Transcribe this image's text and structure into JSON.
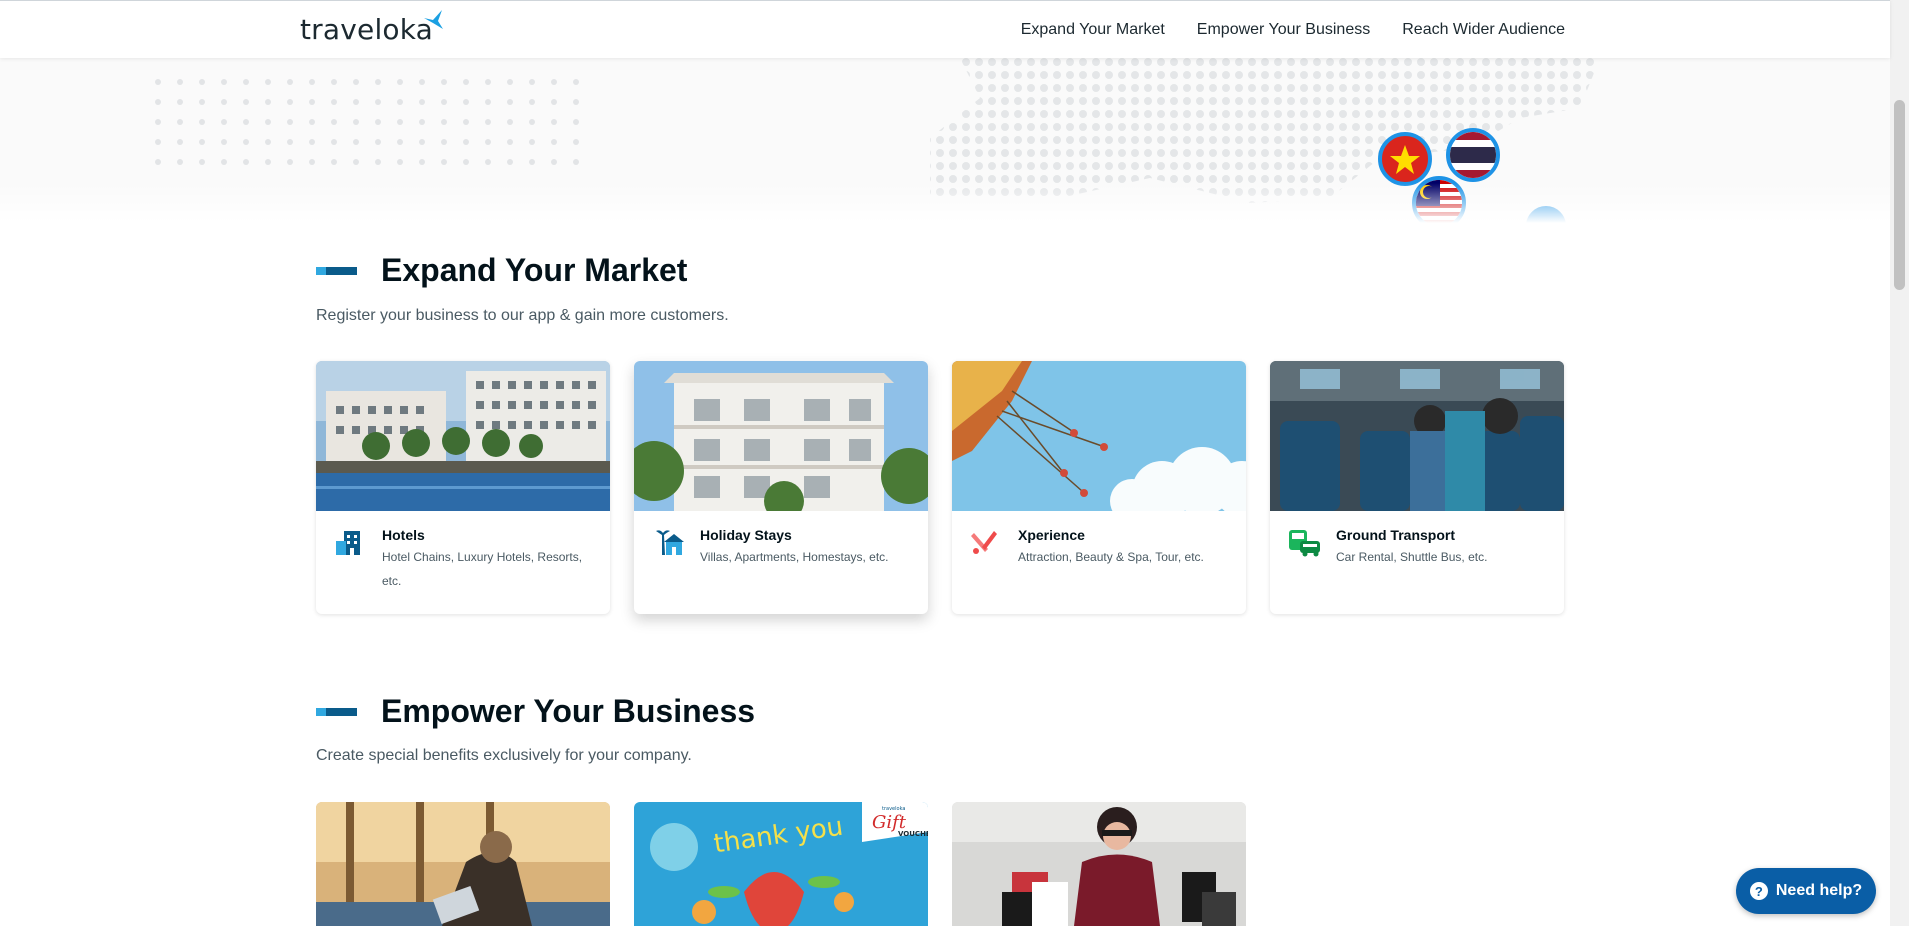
{
  "header": {
    "logo_text": "traveloka",
    "nav": [
      "Expand Your Market",
      "Empower Your Business",
      "Reach Wider Audience"
    ]
  },
  "sections": {
    "expand": {
      "title": "Expand Your Market",
      "subtitle": "Register your business to our app & gain more customers.",
      "cards": [
        {
          "title": "Hotels",
          "desc": "Hotel Chains, Luxury Hotels, Resorts, etc.",
          "icon": "hotel-icon"
        },
        {
          "title": "Holiday Stays",
          "desc": "Villas, Apartments, Homestays, etc.",
          "icon": "palm-house-icon"
        },
        {
          "title": "Xperience",
          "desc": "Attraction, Beauty & Spa, Tour, etc.",
          "icon": "xperience-icon"
        },
        {
          "title": "Ground Transport",
          "desc": "Car Rental, Shuttle Bus, etc.",
          "icon": "bus-car-icon"
        }
      ]
    },
    "empower": {
      "title": "Empower Your Business",
      "subtitle": "Create special benefits exclusively for your company.",
      "voucher_brand": "traveloka",
      "voucher_script": "Gift",
      "voucher_word": "VOUCHER",
      "thank_you": "thank you"
    }
  },
  "help": {
    "label": "Need help?",
    "icon": "question-icon"
  },
  "colors": {
    "brand_dark": "#0a5b8a",
    "brand_light": "#30a8e0",
    "help_bg": "#0a5ea6"
  }
}
